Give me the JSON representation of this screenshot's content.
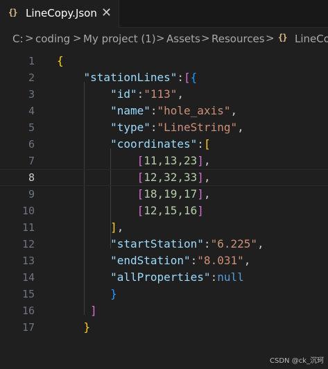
{
  "tab": {
    "icon": "json-braces-icon",
    "icon_text": "{}",
    "label": "LineCopy.Json",
    "close": "✕"
  },
  "breadcrumb": {
    "items": [
      "C:",
      "coding",
      "My project (1)",
      "Assets",
      "Resources",
      "LineCo"
    ],
    "separator": ">",
    "file_icon_text": "{}"
  },
  "editor": {
    "lines": [
      {
        "n": "1",
        "code": [
          [
            "{",
            "b1"
          ]
        ]
      },
      {
        "n": "2",
        "code": [
          [
            "    ",
            "p"
          ],
          [
            "\"stationLines\"",
            "k"
          ],
          [
            ":",
            "p"
          ],
          [
            "[",
            "b2"
          ],
          [
            "{",
            "b3"
          ]
        ]
      },
      {
        "n": "3",
        "code": [
          [
            "        ",
            "p"
          ],
          [
            "\"id\"",
            "k"
          ],
          [
            ":",
            "p"
          ],
          [
            "\"113\"",
            "s"
          ],
          [
            ",",
            "p"
          ]
        ]
      },
      {
        "n": "4",
        "code": [
          [
            "        ",
            "p"
          ],
          [
            "\"name\"",
            "k"
          ],
          [
            ":",
            "p"
          ],
          [
            "\"hole_axis\"",
            "s"
          ],
          [
            ",",
            "p"
          ]
        ]
      },
      {
        "n": "5",
        "code": [
          [
            "        ",
            "p"
          ],
          [
            "\"type\"",
            "k"
          ],
          [
            ":",
            "p"
          ],
          [
            "\"LineString\"",
            "s"
          ],
          [
            ",",
            "p"
          ]
        ]
      },
      {
        "n": "6",
        "code": [
          [
            "        ",
            "p"
          ],
          [
            "\"coordinates\"",
            "k"
          ],
          [
            ":",
            "p"
          ],
          [
            "[",
            "b1"
          ]
        ]
      },
      {
        "n": "7",
        "code": [
          [
            "            ",
            "p"
          ],
          [
            "[",
            "b2"
          ],
          [
            "11,13,23",
            "n"
          ],
          [
            "]",
            "b2"
          ],
          [
            ",",
            "p"
          ]
        ]
      },
      {
        "n": "8",
        "code": [
          [
            "            ",
            "p"
          ],
          [
            "[",
            "b2"
          ],
          [
            "12,32,33",
            "n"
          ],
          [
            "]",
            "b2"
          ],
          [
            ",",
            "p"
          ]
        ]
      },
      {
        "n": "9",
        "code": [
          [
            "            ",
            "p"
          ],
          [
            "[",
            "b2"
          ],
          [
            "18,19,17",
            "n"
          ],
          [
            "]",
            "b2"
          ],
          [
            ",",
            "p"
          ]
        ]
      },
      {
        "n": "10",
        "code": [
          [
            "            ",
            "p"
          ],
          [
            "[",
            "b2"
          ],
          [
            "12,15,16",
            "n"
          ],
          [
            "]",
            "b2"
          ]
        ]
      },
      {
        "n": "11",
        "code": [
          [
            "        ",
            "p"
          ],
          [
            "]",
            "b1"
          ],
          [
            ",",
            "p"
          ]
        ]
      },
      {
        "n": "12",
        "code": [
          [
            "        ",
            "p"
          ],
          [
            "\"startStation\"",
            "k"
          ],
          [
            ":",
            "p"
          ],
          [
            "\"6.225\"",
            "s"
          ],
          [
            ",",
            "p"
          ]
        ]
      },
      {
        "n": "13",
        "code": [
          [
            "        ",
            "p"
          ],
          [
            "\"endStation\"",
            "k"
          ],
          [
            ":",
            "p"
          ],
          [
            "\"8.031\"",
            "s"
          ],
          [
            ",",
            "p"
          ]
        ]
      },
      {
        "n": "14",
        "code": [
          [
            "        ",
            "p"
          ],
          [
            "\"allProperties\"",
            "k"
          ],
          [
            ":",
            "p"
          ],
          [
            "null",
            "nul"
          ]
        ]
      },
      {
        "n": "15",
        "code": [
          [
            "        ",
            "p"
          ],
          [
            "}",
            "b3"
          ]
        ]
      },
      {
        "n": "16",
        "code": [
          [
            "     ",
            "p"
          ],
          [
            "]",
            "b2"
          ]
        ]
      },
      {
        "n": "17",
        "code": [
          [
            "    ",
            "p"
          ],
          [
            "}",
            "b1"
          ]
        ]
      }
    ],
    "active_line": "8"
  },
  "watermark": "CSDN @ck_沉珂",
  "colors": {
    "background": "#1f1f1f",
    "key": "#9cdcfe",
    "string": "#ce9178",
    "number": "#b5cea8",
    "null": "#569cd6",
    "bracket_gold": "#ffd700",
    "bracket_purple": "#da70d6",
    "bracket_blue": "#179fff"
  }
}
